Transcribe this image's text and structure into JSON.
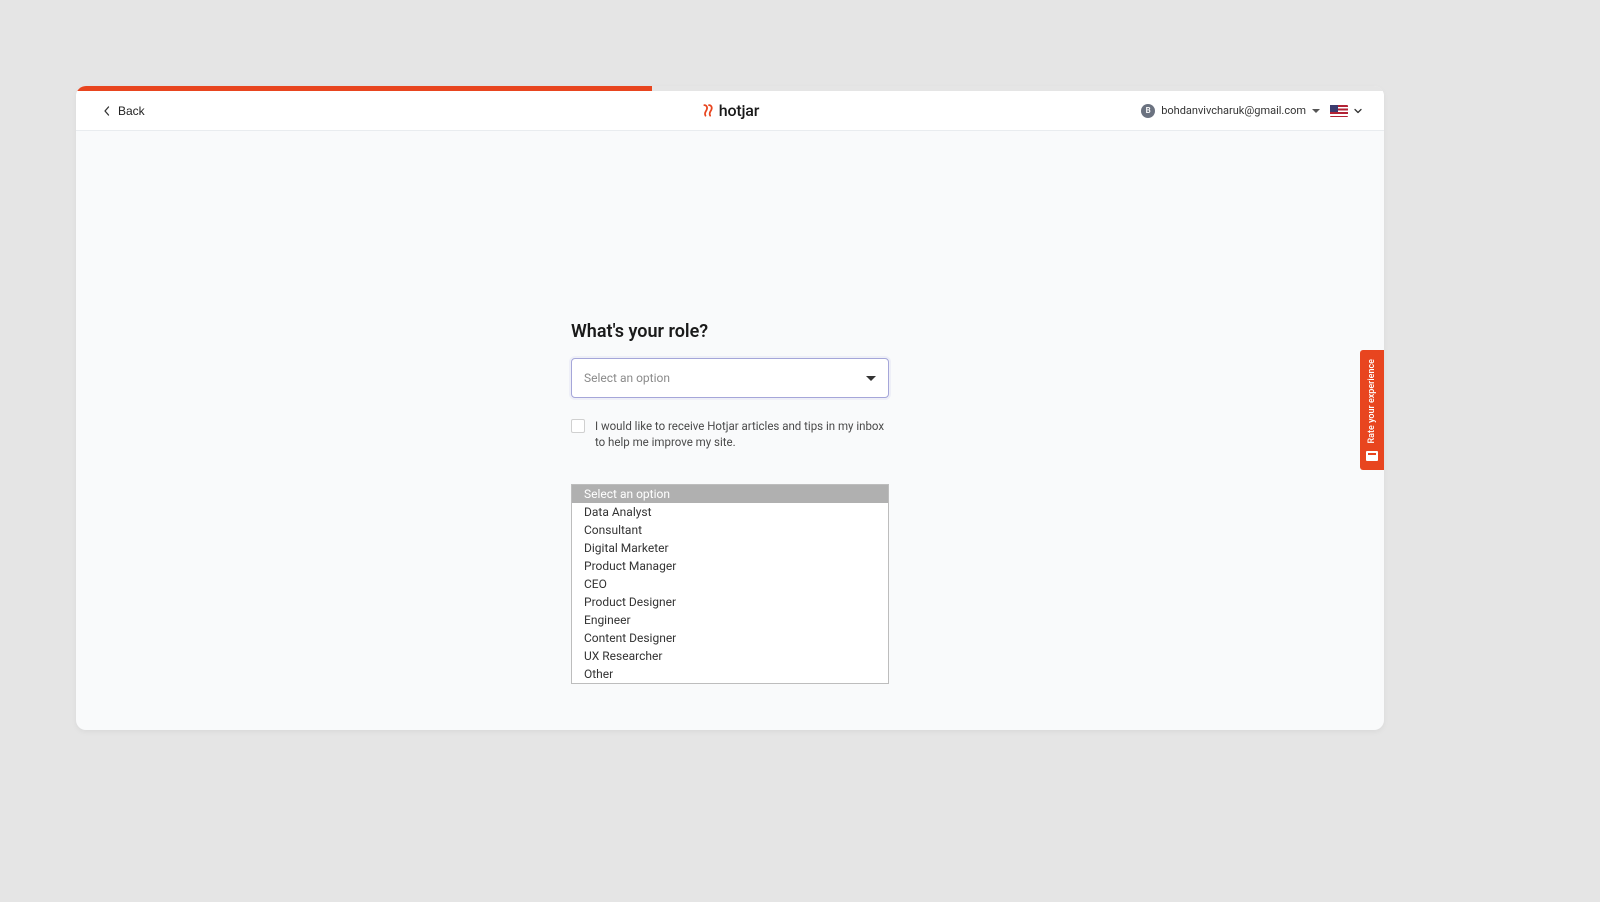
{
  "header": {
    "back_label": "Back",
    "logo_text": "hotjar",
    "user_email": "bohdanvivcharuk@gmail.com",
    "user_initial": "B"
  },
  "form": {
    "heading": "What's your role?",
    "select_placeholder": "Select an option",
    "checkbox_label": "I would like to receive Hotjar articles and tips in my inbox to help me improve my site.",
    "options": [
      "Select an option",
      "Data Analyst",
      "Consultant",
      "Digital Marketer",
      "Product Manager",
      "CEO",
      "Product Designer",
      "Engineer",
      "Content Designer",
      "UX Researcher",
      "Other"
    ]
  },
  "feedback": {
    "label": "Rate your experience"
  },
  "colors": {
    "accent": "#e8451f"
  }
}
